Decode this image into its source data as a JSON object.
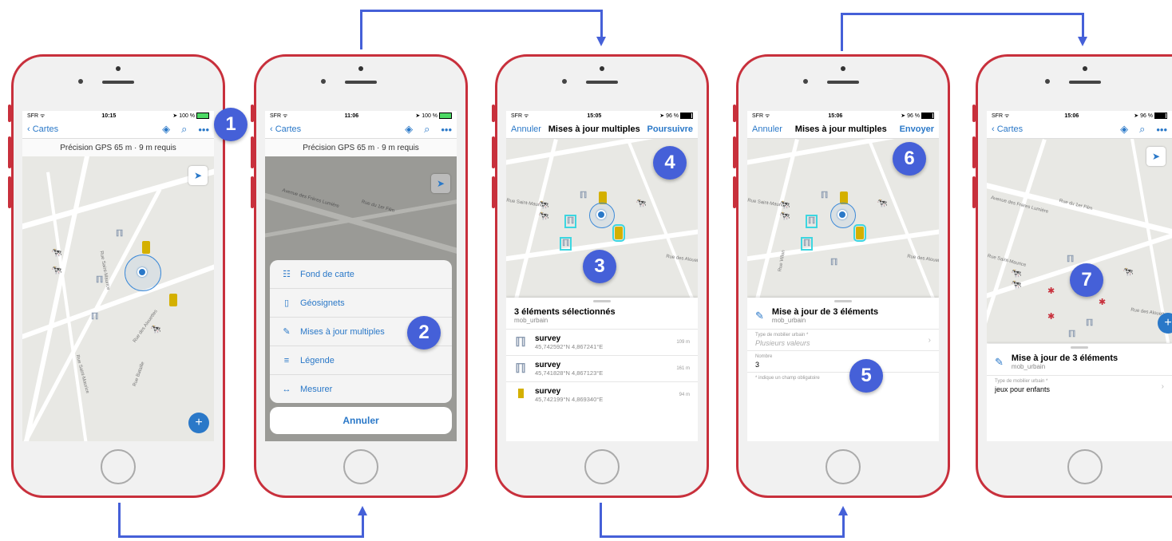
{
  "colors": {
    "accent": "#2a78c8",
    "badge": "#4560d8",
    "phone": "#c8303c"
  },
  "status": {
    "p1": {
      "carrier": "SFR",
      "time": "10:15",
      "battery": "100 %"
    },
    "p2": {
      "carrier": "SFR",
      "time": "11:06",
      "battery": "100 %"
    },
    "p3": {
      "carrier": "SFR",
      "time": "15:05",
      "battery": "96 %"
    },
    "p4": {
      "carrier": "SFR",
      "time": "15:06",
      "battery": "96 %"
    },
    "p5": {
      "carrier": "SFR",
      "time": "15:06",
      "battery": "96 %"
    }
  },
  "nav": {
    "back": "Cartes",
    "cancel": "Annuler",
    "multi_title": "Mises à jour multiples",
    "continue": "Poursuivre",
    "send": "Envoyer"
  },
  "gps_text": "Précision GPS 65 m · 9 m requis",
  "menu": {
    "items": [
      {
        "icon": "grid-icon",
        "glyph": "☷",
        "label": "Fond de carte"
      },
      {
        "icon": "book-icon",
        "glyph": "▯",
        "label": "Géosignets"
      },
      {
        "icon": "edit-icon",
        "glyph": "✎",
        "label": "Mises à jour multiples"
      },
      {
        "icon": "list-icon",
        "glyph": "≡",
        "label": "Légende"
      },
      {
        "icon": "measure-icon",
        "glyph": "↔",
        "label": "Mesurer"
      }
    ],
    "cancel": "Annuler"
  },
  "selection": {
    "title": "3 éléments sélectionnés",
    "layer": "mob_urbain",
    "rows": [
      {
        "name": "survey",
        "coords": "45,742592°N 4,867241°E",
        "dist": "109 m",
        "icon": "bench"
      },
      {
        "name": "survey",
        "coords": "45,741828°N 4,867123°E",
        "dist": "161 m",
        "icon": "bench"
      },
      {
        "name": "survey",
        "coords": "45,742199°N 4,869340°E",
        "dist": "94 m",
        "icon": "bin"
      }
    ]
  },
  "update": {
    "title": "Mise à jour de 3 éléments",
    "layer": "mob_urbain",
    "field1_label": "Type de mobilier urbain *",
    "field1_value": "Plusieurs valeurs",
    "field2_label": "Nombre",
    "field2_value": "3",
    "note": "* indique un champ obligatoire",
    "final_value": "jeux pour enfants"
  },
  "map_labels": {
    "a": "Avenue des Frères Lumière",
    "b": "Rue du 1er Film",
    "c": "Rue Saint-Maurice",
    "d": "Rue des Alouettes",
    "e": "Rue Villon",
    "f": "Rue Bataille"
  },
  "badges": [
    "1",
    "2",
    "3",
    "4",
    "5",
    "6",
    "7"
  ]
}
